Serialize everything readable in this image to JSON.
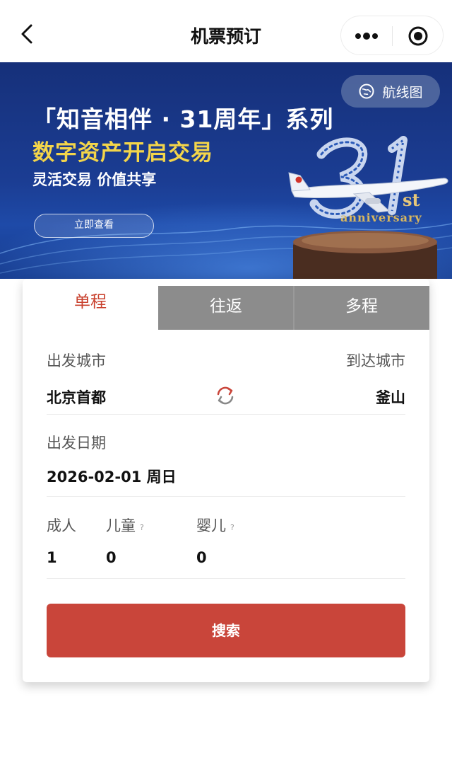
{
  "header": {
    "title": "机票预订",
    "back_icon": "chevron-left-icon",
    "more_icon": "more-dots-icon",
    "close_icon": "target-circle-icon"
  },
  "banner": {
    "title": "「知音相伴 · 31周年」系列",
    "subtitle": "数字资产开启交易",
    "tagline": "灵活交易 价值共享",
    "cta_label": "立即查看",
    "route_map_label": "航线图",
    "route_map_icon": "globe-icon",
    "anniversary_suffix": "st",
    "anniversary_word": "anniversary",
    "colors": {
      "background": "#1b3d93",
      "subtitle": "#f3d54a",
      "gold": "#d8b75f"
    }
  },
  "tabs": [
    {
      "label": "单程",
      "active": true
    },
    {
      "label": "往返",
      "active": false
    },
    {
      "label": "多程",
      "active": false
    }
  ],
  "form": {
    "departure_city_label": "出发城市",
    "departure_city": "北京首都",
    "arrival_city_label": "到达城市",
    "arrival_city": "釜山",
    "swap_icon": "swap-arrows-icon",
    "date_label": "出发日期",
    "date_value": "2026-02-01 周日",
    "passengers": {
      "adult_label": "成人",
      "adult_count": "1",
      "child_label": "儿童",
      "child_count": "0",
      "infant_label": "婴儿",
      "infant_count": "0",
      "help_mark": "?"
    },
    "search_label": "搜索"
  },
  "colors": {
    "accent": "#c9453a",
    "active_tab_text": "#c9412e",
    "inactive_tab": "#8c8c8c"
  }
}
